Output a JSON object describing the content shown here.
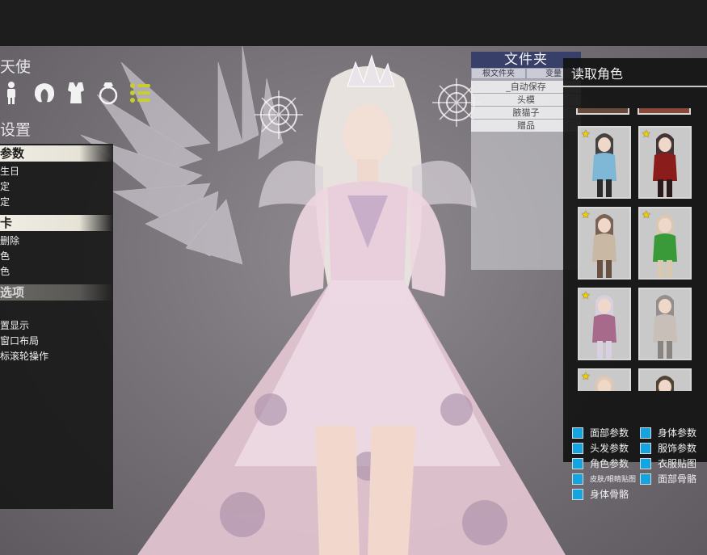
{
  "left": {
    "title": "天使",
    "subtitle": "设置",
    "icons": [
      "body-icon",
      "hair-icon",
      "clothes-icon",
      "accessory-icon",
      "list-icon"
    ],
    "sections": [
      {
        "header": "参数",
        "items": [
          "生日",
          "定",
          "定"
        ]
      },
      {
        "header": "卡",
        "items": [
          "删除",
          "色",
          "色"
        ]
      },
      {
        "header": "选项",
        "items": [
          "",
          "置显示",
          "窗口布局",
          "标滚轮操作"
        ]
      }
    ]
  },
  "folder": {
    "title": "文件夹",
    "tabs": [
      "根文件夹",
      "变量"
    ],
    "items": [
      "_自动保存",
      "头模",
      "腋猫子",
      "赠品"
    ]
  },
  "right": {
    "title": "读取角色",
    "thumbs": [
      {
        "star": true,
        "colors": [
          "#7fb7d6",
          "#2a2a2a"
        ]
      },
      {
        "star": true,
        "colors": [
          "#8a1c1c",
          "#2a1a1a"
        ]
      },
      {
        "star": true,
        "colors": [
          "#c9b8a4",
          "#6a5040"
        ]
      },
      {
        "star": true,
        "colors": [
          "#3a9a3a",
          "#d8c8b0"
        ]
      },
      {
        "star": true,
        "colors": [
          "#a86a8a",
          "#d8d0e0"
        ]
      },
      {
        "star": false,
        "colors": [
          "#c8c0b8",
          "#8a8480"
        ]
      },
      {
        "star": true,
        "colors": [
          "#6a7a9a",
          "#e0c8b0"
        ]
      },
      {
        "star": false,
        "colors": [
          "#7a5020",
          "#3a2a1a"
        ]
      }
    ],
    "checkboxes": [
      [
        "面部参数",
        "身体参数"
      ],
      [
        "头发参数",
        "服饰参数"
      ],
      [
        "角色参数",
        "衣服贴图"
      ],
      [
        "皮肤/眼睛贴图",
        "面部骨骼"
      ],
      [
        "身体骨骼"
      ]
    ],
    "accent": "#14a4e0"
  }
}
